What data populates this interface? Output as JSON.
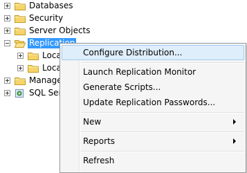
{
  "tree": {
    "nodes": [
      {
        "label": "Databases"
      },
      {
        "label": "Security"
      },
      {
        "label": "Server Objects"
      },
      {
        "label": "Replication"
      },
      {
        "label": "Loca"
      },
      {
        "label": "Loca"
      },
      {
        "label": "Manage"
      },
      {
        "label": "SQL Ser"
      }
    ]
  },
  "context_menu": {
    "items": [
      {
        "label": "Configure Distribution...",
        "highlighted": true
      },
      {
        "label": "Launch Replication Monitor"
      },
      {
        "label": "Generate Scripts..."
      },
      {
        "label": "Update Replication Passwords..."
      },
      {
        "label": "New",
        "has_submenu": true
      },
      {
        "label": "Reports",
        "has_submenu": true
      },
      {
        "label": "Refresh"
      }
    ]
  },
  "colors": {
    "selection": "#3399ff",
    "menu_highlight": "#dfeefb",
    "menu_highlight_border": "#9ccbf2",
    "folder_fill": "#f5d469",
    "folder_outline": "#c29a2a"
  }
}
